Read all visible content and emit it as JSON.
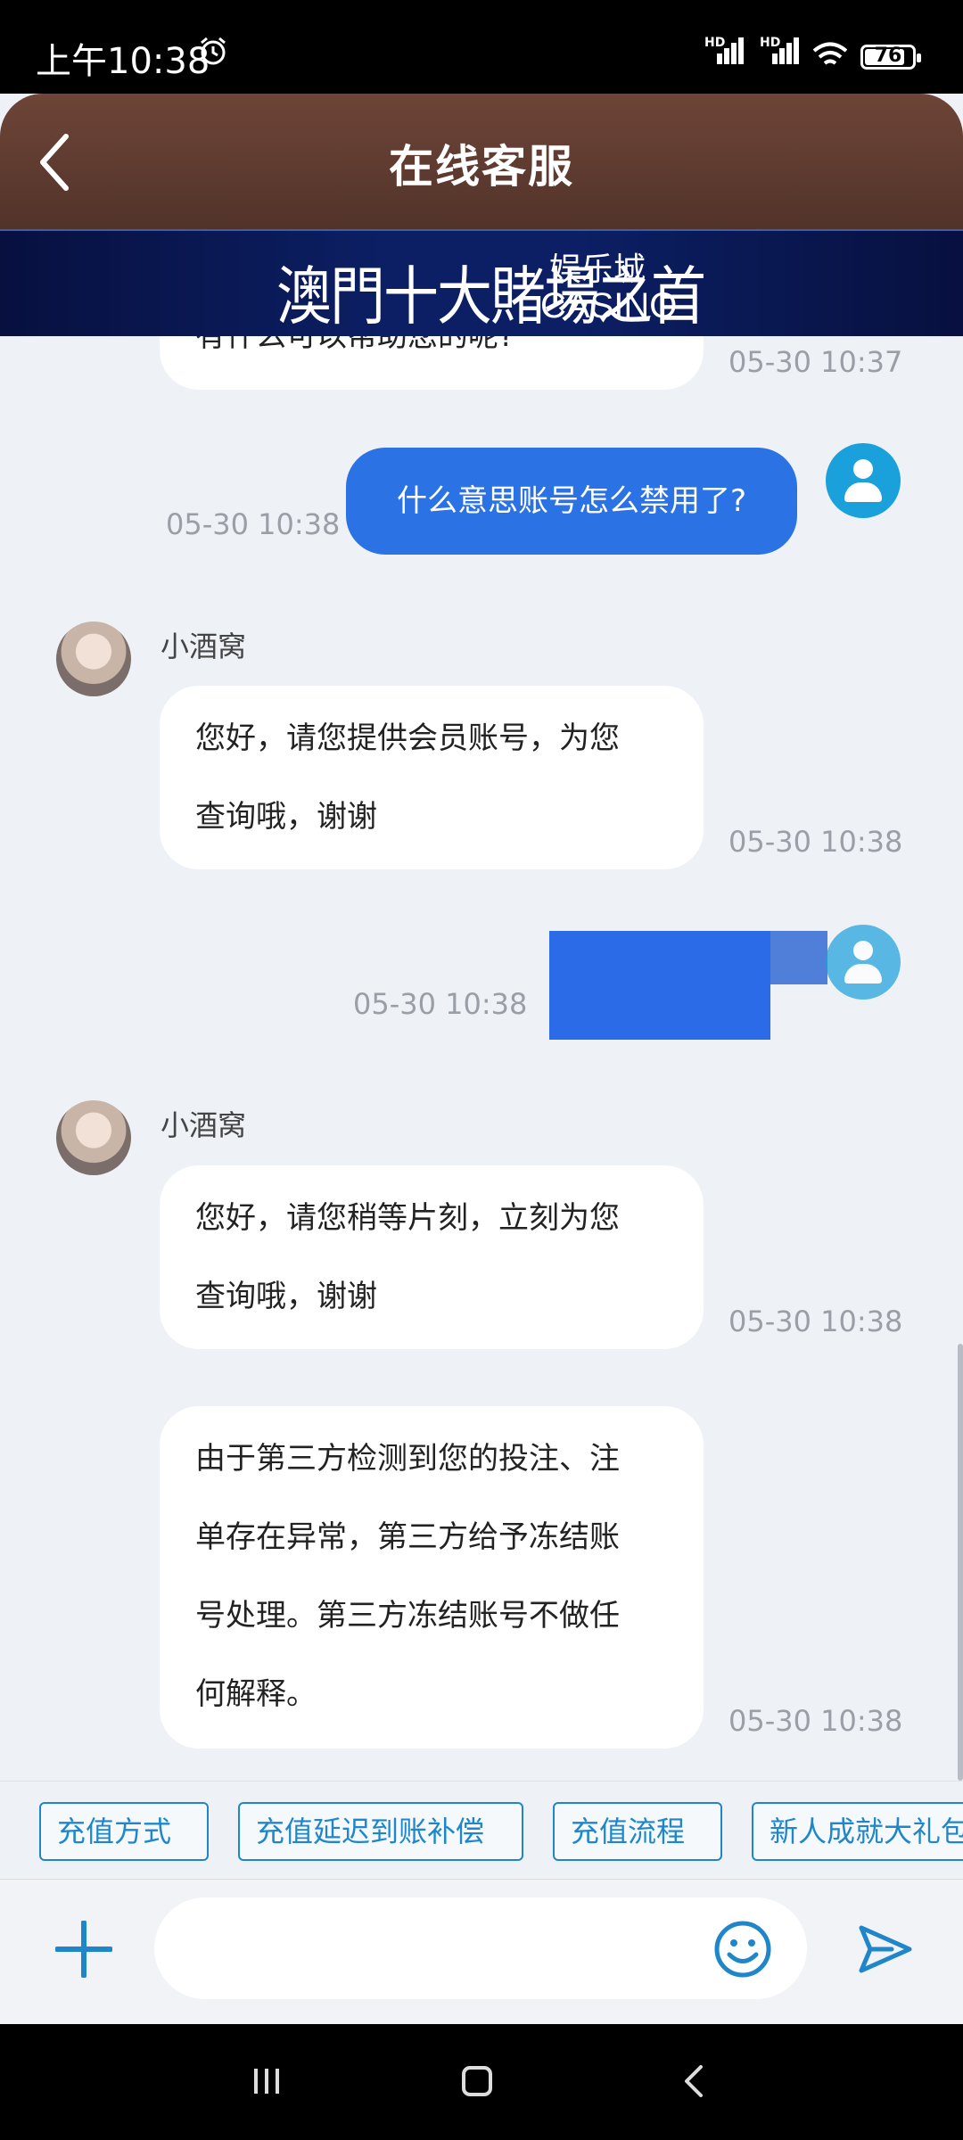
{
  "status_bar": {
    "time": "上午10:38",
    "network1": "HD",
    "network2": "HD",
    "battery": "76"
  },
  "header": {
    "title": "在线客服"
  },
  "banner": {
    "main": "澳門十大賭場之首",
    "sub1": "娱乐城",
    "sub2": "CASINO"
  },
  "chat": {
    "messages": [
      {
        "side": "agent",
        "text": "有什么可以帮助您的呢?",
        "time": "05-30 10:37"
      },
      {
        "side": "user",
        "text": "什么意思账号怎么禁用了?",
        "time": "05-30 10:38"
      },
      {
        "side": "agent",
        "name": "小酒窝",
        "line1": "您好，请您提供会员账号，为您",
        "line2": "查询哦，谢谢",
        "time": "05-30 10:38"
      },
      {
        "side": "user",
        "text": "",
        "time": "05-30 10:38",
        "redacted": true
      },
      {
        "side": "agent",
        "name": "小酒窝",
        "line1": " 您好，请您稍等片刻，立刻为您",
        "line2": "查询哦，谢谢",
        "time": "05-30 10:38"
      },
      {
        "side": "agent",
        "line1": "由于第三方检测到您的投注、注",
        "line2": "单存在异常，第三方给予冻结账",
        "line3": "号处理。第三方冻结账号不做任",
        "line4": "何解释。",
        "time": "05-30 10:38"
      }
    ]
  },
  "quick_replies": [
    "充值方式",
    "充值延迟到账补偿",
    "充值流程",
    "新人成就大礼包"
  ],
  "input": {
    "placeholder": ""
  },
  "icons": {
    "back": "chevron-left-icon",
    "alarm": "alarm-clock-icon",
    "add": "plus-icon",
    "emoji": "smiley-icon",
    "send": "send-icon"
  },
  "colors": {
    "header": "#5e3b30",
    "banner": "#0c1f64",
    "user_bubble": "#2b72e4",
    "accent": "#1f86c9"
  }
}
